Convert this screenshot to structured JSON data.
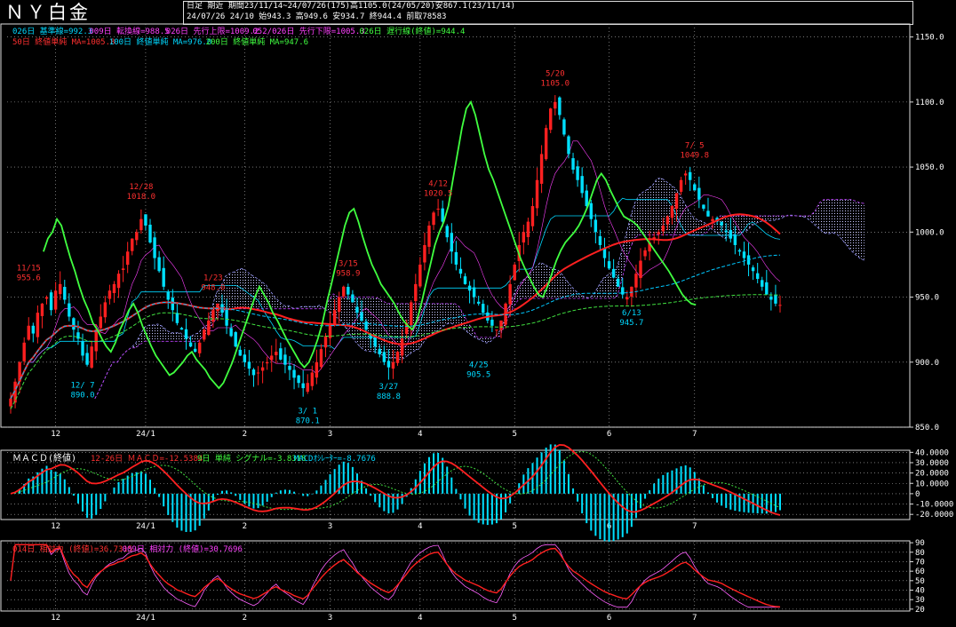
{
  "title": "ＮＹ白金",
  "header": {
    "line1": "日足 期近 期間23/11/14~24/07/26(175)高1105.0(24/05/20)安867.1(23/11/14)",
    "line2": "24/07/26 24/10 始943.3 高949.6 安934.7 終944.4 前取78583"
  },
  "colors": {
    "background": "#000000",
    "up": "#ff2020",
    "down": "#00e0ff",
    "ma50": "#ff2020",
    "ma100": "#00c8ff",
    "ma200": "#40e040",
    "chikou": "#40ff40",
    "kumo": "#9a9aff",
    "macd": "#ff2020",
    "signal": "#40e040",
    "rsi14": "#ff2020",
    "rsi9": "#ff60ff"
  },
  "legends": {
    "ichimoku1": [
      {
        "text": "026日 基準線=992.3",
        "color": "#00d8ff"
      },
      {
        "text": "009日 転換線=988.5",
        "color": "#ff40ff"
      },
      {
        "text": "026日 先行上限=1009.2",
        "color": "#ff40ff"
      },
      {
        "text": "052/026日 先行下限=1005.3",
        "color": "#ff40ff"
      },
      {
        "text": "026日 遅行線(終値)=944.4",
        "color": "#40ff40"
      }
    ],
    "ma": [
      {
        "text": "50日 終値単純 MA=1005.8",
        "color": "#ff3030"
      },
      {
        "text": "100日 終値単純 MA=976.0",
        "color": "#00d8ff"
      },
      {
        "text": "200日 終値単純 MA=947.6",
        "color": "#40ff40"
      }
    ],
    "macd_label": "ＭＡＣＤ(終値)",
    "macd": [
      {
        "text": "12-26日 ＭＡＣＤ=-12.5384",
        "color": "#ff3030"
      },
      {
        "text": "9日 単純 シグナル=-3.8318",
        "color": "#40ff40"
      },
      {
        "text": "MACDｵｼﾚｰﾀｰ=-8.7676",
        "color": "#00d8ff"
      }
    ],
    "rsi": [
      {
        "text": "014日 相対力 (終値)=36.7315",
        "color": "#ff3030"
      },
      {
        "text": "009日 相対力 (終値)=30.7696",
        "color": "#ff40ff"
      }
    ]
  },
  "chart_data": {
    "type": "candlestick",
    "x_tick_labels": [
      "12",
      "24/1",
      "2",
      "3",
      "4",
      "5",
      "6",
      "7"
    ],
    "price": {
      "ylim": [
        850,
        1160
      ],
      "y_ticks": [
        850,
        900,
        950,
        1000,
        1050,
        1100,
        1150
      ],
      "y_tick_labels": [
        "850.0",
        "900.0",
        "950.0",
        "1000.0",
        "1050.0",
        "1100.0",
        "1150.0"
      ],
      "close": [
        872,
        885,
        900,
        915,
        928,
        922,
        938,
        945,
        950,
        940,
        955,
        960,
        948,
        935,
        925,
        918,
        905,
        898,
        912,
        925,
        935,
        946,
        955,
        960,
        968,
        972,
        985,
        995,
        1000,
        1010,
        1005,
        992,
        980,
        970,
        958,
        948,
        940,
        930,
        925,
        918,
        912,
        908,
        915,
        925,
        932,
        940,
        945,
        938,
        928,
        920,
        912,
        905,
        900,
        895,
        890,
        892,
        896,
        900,
        905,
        908,
        902,
        898,
        894,
        888,
        884,
        880,
        884,
        892,
        900,
        910,
        920,
        930,
        940,
        950,
        958,
        952,
        946,
        938,
        932,
        925,
        918,
        912,
        906,
        900,
        896,
        900,
        908,
        918,
        930,
        946,
        960,
        975,
        990,
        1005,
        1015,
        1018,
        1008,
        996,
        985,
        975,
        968,
        960,
        955,
        950,
        945,
        938,
        932,
        928,
        925,
        932,
        945,
        960,
        975,
        990,
        1000,
        1008,
        1020,
        1040,
        1060,
        1080,
        1095,
        1100,
        1090,
        1075,
        1060,
        1048,
        1040,
        1030,
        1020,
        1010,
        1000,
        990,
        980,
        972,
        965,
        958,
        952,
        950,
        958,
        968,
        978,
        986,
        992,
        996,
        1000,
        1005,
        1012,
        1020,
        1030,
        1040,
        1045,
        1040,
        1032,
        1025,
        1018,
        1012,
        1010,
        1008,
        1005,
        1000,
        995,
        990,
        985,
        980,
        975,
        970,
        964,
        958,
        952,
        948,
        945,
        944
      ],
      "annotations": [
        {
          "label": "11/15",
          "value": "955.6",
          "idx": 4,
          "side": "high"
        },
        {
          "label": "12/ 7",
          "value": "890.0",
          "idx": 16,
          "side": "low"
        },
        {
          "label": "12/28",
          "value": "1018.0",
          "idx": 29,
          "side": "high"
        },
        {
          "label": "1/23",
          "value": "948.0",
          "idx": 45,
          "side": "high"
        },
        {
          "label": "3/ 1",
          "value": "870.1",
          "idx": 66,
          "side": "low"
        },
        {
          "label": "3/15",
          "value": "958.9",
          "idx": 75,
          "side": "high"
        },
        {
          "label": "3/27",
          "value": "888.8",
          "idx": 84,
          "side": "low"
        },
        {
          "label": "4/12",
          "value": "1020.5",
          "idx": 95,
          "side": "high"
        },
        {
          "label": "4/25",
          "value": "905.5",
          "idx": 104,
          "side": "low"
        },
        {
          "label": "5/20",
          "value": "1105.0",
          "idx": 121,
          "side": "high"
        },
        {
          "label": "6/13",
          "value": "945.7",
          "idx": 138,
          "side": "low"
        },
        {
          "label": "7/ 5",
          "value": "1049.8",
          "idx": 152,
          "side": "high"
        }
      ]
    },
    "macd": {
      "ylim": [
        -25,
        42
      ],
      "y_ticks": [
        -20,
        -10,
        0,
        10,
        20,
        30,
        40
      ],
      "y_tick_labels": [
        "-20.0000",
        "-10.0000",
        "0",
        "10.0000",
        "20.0000",
        "30.0000",
        "40.0000"
      ]
    },
    "rsi": {
      "ylim": [
        18,
        92
      ],
      "y_ticks": [
        20,
        30,
        40,
        50,
        60,
        70,
        80,
        90
      ],
      "y_tick_labels": [
        "20",
        "30",
        "40",
        "50",
        "60",
        "70",
        "80",
        "90"
      ]
    }
  }
}
